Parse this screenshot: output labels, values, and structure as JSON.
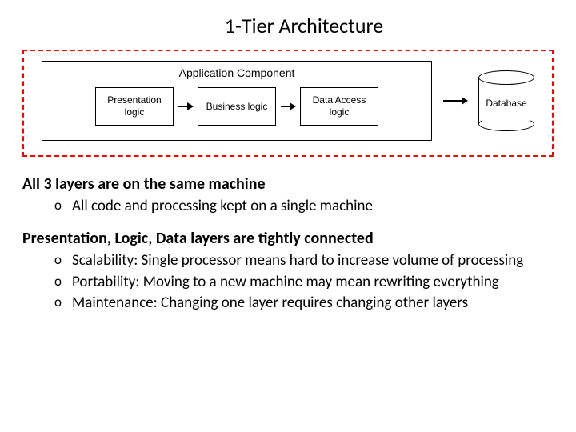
{
  "title": "1-Tier Architecture",
  "diagram": {
    "container_label": "Application Component",
    "boxes": [
      "Presentation logic",
      "Business logic",
      "Data Access logic"
    ],
    "db_label": "Database"
  },
  "sections": [
    {
      "heading": "All 3 layers are on the same machine",
      "bullets": [
        "All code and processing kept on a single machine"
      ]
    },
    {
      "heading": "Presentation, Logic, Data layers are tightly connected",
      "bullets": [
        "Scalability: Single processor means hard to increase volume of processing",
        "Portability: Moving to a new machine may mean rewriting everything",
        "Maintenance: Changing one layer requires changing other layers"
      ]
    }
  ]
}
